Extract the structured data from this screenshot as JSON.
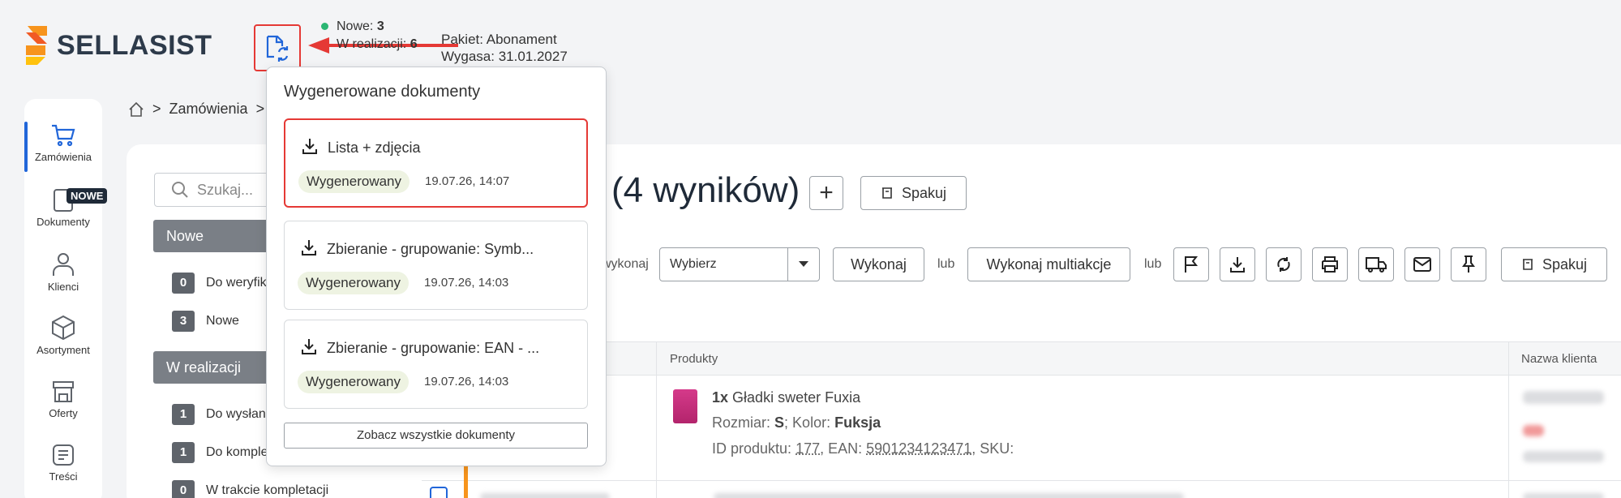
{
  "brand": {
    "name": "SELLASIST",
    "colors": {
      "logo_orange": "#f7941d",
      "logo_yellow": "#ffc20e",
      "accent_red": "#e53935",
      "accent_blue": "#2166d9"
    }
  },
  "header": {
    "doc_button_icon": "document-refresh-icon",
    "status": [
      {
        "label": "Nowe:",
        "value": "3"
      },
      {
        "label": "W realizacji:",
        "value": "6"
      }
    ],
    "package_line": "Pakiet: Abonament",
    "expiry_line": "Wygasa: 31.01.2027"
  },
  "sidebar": {
    "items": [
      {
        "label": "Zamówienia",
        "icon": "cart-icon"
      },
      {
        "label": "Dokumenty",
        "icon": "document-icon",
        "badge": "NOWE"
      },
      {
        "label": "Klienci",
        "icon": "user-icon"
      },
      {
        "label": "Asortyment",
        "icon": "box-icon"
      },
      {
        "label": "Oferty",
        "icon": "shop-icon"
      },
      {
        "label": "Treści",
        "icon": "content-icon"
      }
    ]
  },
  "breadcrumb": {
    "home_icon": "home-icon",
    "current": "Zamówienia",
    "separator": ">"
  },
  "filters": {
    "search_placeholder": "Szukaj...",
    "groups": [
      {
        "title": "Nowe",
        "items": [
          {
            "count": "0",
            "label": "Do weryfik"
          },
          {
            "count": "3",
            "label": "Nowe"
          }
        ]
      },
      {
        "title": "W realizacji",
        "items": [
          {
            "count": "1",
            "label": "Do wysłan"
          },
          {
            "count": "1",
            "label": "Do komple"
          },
          {
            "count": "0",
            "label": "W trakcie kompletacji"
          }
        ]
      }
    ]
  },
  "main": {
    "results_title": "(4 wyników)",
    "add_button": "+",
    "pack_button": "Spakuj",
    "actions": {
      "execute_label": "wykonaj",
      "select_value": "Wybierz",
      "execute_button": "Wykonaj",
      "or1": "lub",
      "multi_button": "Wykonaj multiakcje",
      "or2": "lub",
      "pack_button2": "Spakuj"
    },
    "table": {
      "columns": [
        "Produkty",
        "Nazwa klienta"
      ],
      "row1": {
        "qty": "1x",
        "product": "Gładki sweter Fuxia",
        "size_label": "Rozmiar:",
        "size": "S",
        "color_label": "; Kolor:",
        "color": "Fuksja",
        "id_line_prefix": "ID produktu:",
        "id": "177",
        "ean_prefix": ", EAN:",
        "ean": "5901234123471",
        "sku_suffix": ", SKU:"
      }
    }
  },
  "popup": {
    "title": "Wygenerowane dokumenty",
    "documents": [
      {
        "name": "Lista + zdjęcia",
        "status": "Wygenerowany",
        "date": "19.07.26, 14:07"
      },
      {
        "name": "Zbieranie - grupowanie: Symb...",
        "status": "Wygenerowany",
        "date": "19.07.26, 14:03"
      },
      {
        "name": "Zbieranie - grupowanie: EAN - ...",
        "status": "Wygenerowany",
        "date": "19.07.26, 14:03"
      }
    ],
    "see_all": "Zobacz wszystkie dokumenty"
  }
}
